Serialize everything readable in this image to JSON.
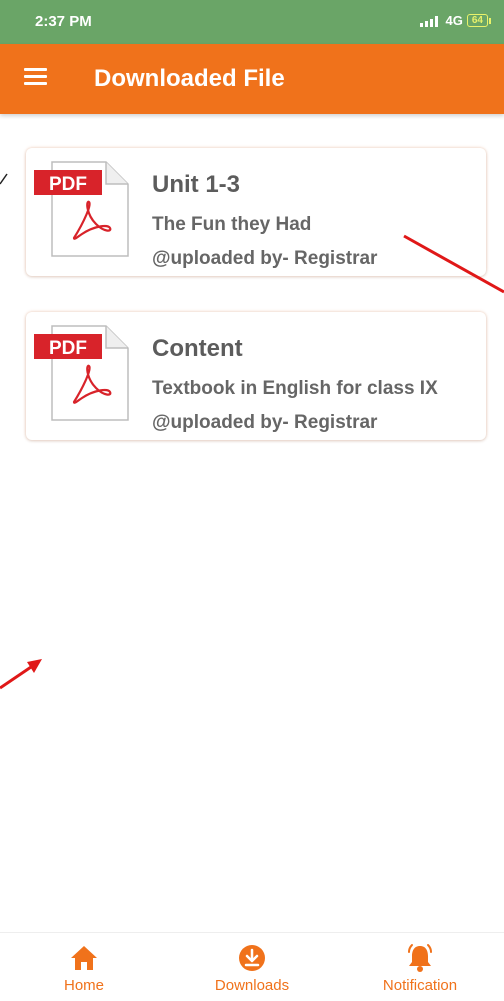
{
  "status_bar": {
    "time": "2:37 PM",
    "network": "4G",
    "battery": "64"
  },
  "app_bar": {
    "title": "Downloaded File",
    "menu_icon": "hamburger-menu-icon"
  },
  "files": [
    {
      "icon_label": "PDF",
      "title": "Unit 1-3",
      "subtitle": "The Fun they Had",
      "uploader": "@uploaded by- Registrar"
    },
    {
      "icon_label": "PDF",
      "title": "Content",
      "subtitle": "Textbook in English for class IX",
      "uploader": "@uploaded by- Registrar"
    }
  ],
  "bottom_nav": [
    {
      "label": "Home",
      "icon": "home-icon"
    },
    {
      "label": "Downloads",
      "icon": "download-icon"
    },
    {
      "label": "Notification",
      "icon": "bell-icon"
    }
  ],
  "colors": {
    "accent": "#f0721b",
    "status_bar": "#6aa567",
    "pdf_red": "#d8232a",
    "text": "#5c5c5c"
  }
}
